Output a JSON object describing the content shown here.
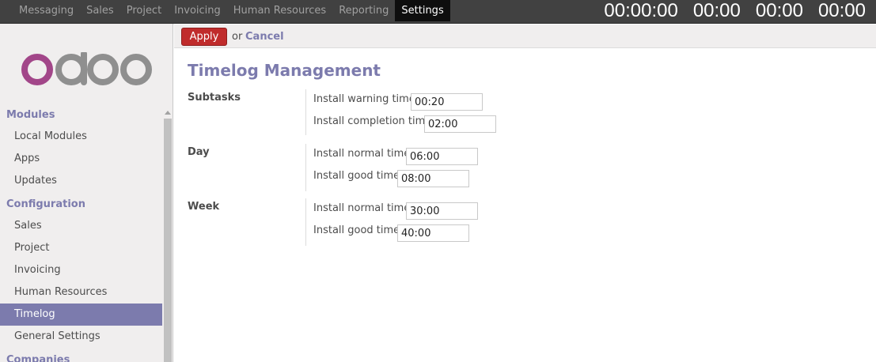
{
  "topbar": {
    "menu": [
      "Messaging",
      "Sales",
      "Project",
      "Invoicing",
      "Human Resources",
      "Reporting",
      "Settings"
    ],
    "active_menu": "Settings",
    "timers": [
      "00:00:00",
      "00:00",
      "00:00",
      "00:00"
    ]
  },
  "logo": {
    "text": "odoo"
  },
  "sidebar": {
    "sections": [
      {
        "title": "Modules",
        "items": [
          "Local Modules",
          "Apps",
          "Updates"
        ]
      },
      {
        "title": "Configuration",
        "items": [
          "Sales",
          "Project",
          "Invoicing",
          "Human Resources",
          "Timelog",
          "General Settings"
        ]
      },
      {
        "title": "Companies",
        "items": []
      }
    ],
    "active_item": "Timelog"
  },
  "actionbar": {
    "apply_label": "Apply",
    "or_text": "or",
    "cancel_label": "Cancel"
  },
  "page": {
    "title": "Timelog Management",
    "groups": [
      {
        "label": "Subtasks",
        "fields": [
          {
            "label": "Install warning time",
            "value": "00:20"
          },
          {
            "label": "Install completion time",
            "value": "02:00"
          }
        ]
      },
      {
        "label": "Day",
        "fields": [
          {
            "label": "Install normal time",
            "value": "06:00"
          },
          {
            "label": "Install good time",
            "value": "08:00"
          }
        ]
      },
      {
        "label": "Week",
        "fields": [
          {
            "label": "Install normal time",
            "value": "30:00"
          },
          {
            "label": "Install good time",
            "value": "40:00"
          }
        ]
      }
    ]
  },
  "colors": {
    "accent": "#7c7bad",
    "apply": "#c02c2c",
    "topbar": "#414141"
  }
}
